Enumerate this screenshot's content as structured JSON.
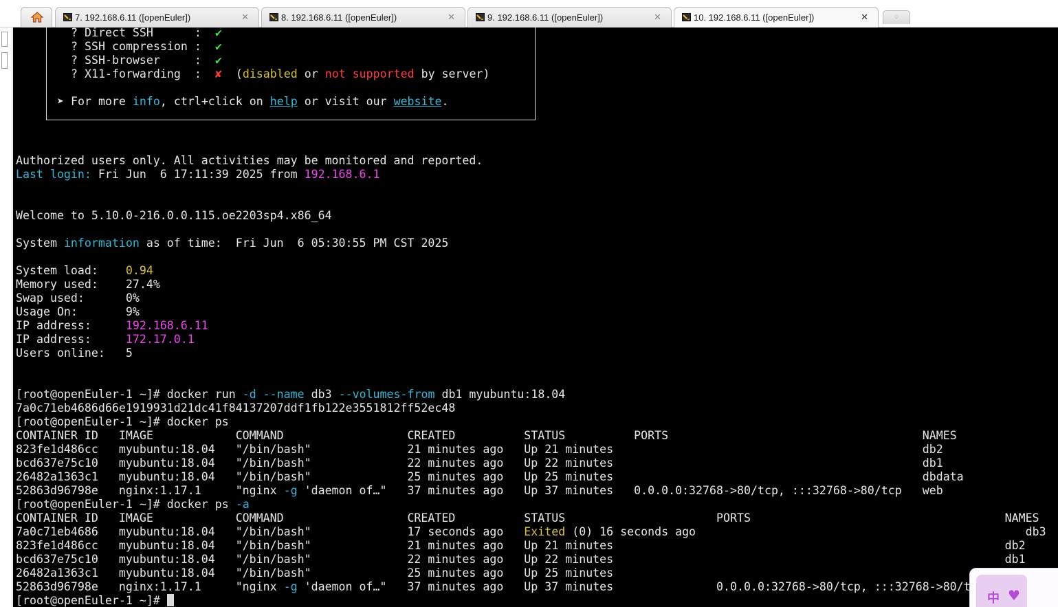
{
  "tabs": {
    "home_icon": "home-icon",
    "session_icon": "terminal-session-icon",
    "close_glyph": "✕",
    "new_tab_glyph": "◌",
    "items": [
      {
        "label": "7. 192.168.6.11 ([openEuler])"
      },
      {
        "label": "8. 192.168.6.11 ([openEuler])"
      },
      {
        "label": "9. 192.168.6.11 ([openEuler])"
      },
      {
        "label": "10. 192.168.6.11 ([openEuler])"
      }
    ],
    "active_index": 3
  },
  "colors": {
    "terminal_bg": "#000000",
    "terminal_fg": "#e6e6e6",
    "ok_green": "#3fe03f",
    "error_red": "#ff3b3b",
    "warn_yellow": "#d6c23a",
    "ip_magenta": "#f046f0",
    "info_cyan": "#36b7d8"
  },
  "banner": {
    "features": [
      {
        "bullet": "?",
        "name": "Direct SSH      ",
        "sep": ":",
        "mark": "✔"
      },
      {
        "bullet": "?",
        "name": "SSH compression ",
        "sep": ":",
        "mark": "✔"
      },
      {
        "bullet": "?",
        "name": "SSH-browser     ",
        "sep": ":",
        "mark": "✔"
      },
      {
        "bullet": "?",
        "name": "X11-forwarding  ",
        "sep": ":",
        "mark": "✘"
      }
    ],
    "x11_note": {
      "open": "(",
      "disabled": "disabled",
      "or": " or ",
      "not_supported": "not supported",
      "rest": " by server)"
    },
    "more": {
      "arrow": "➤",
      "prefix": " For more ",
      "info": "info",
      "mid": ", ctrl+click on ",
      "help": "help",
      "mid2": " or visit our ",
      "website": "website",
      "end": "."
    }
  },
  "login": {
    "authorized": "Authorized users only. All activities may be monitored and reported.",
    "last_login_label": "Last login:",
    "last_login_value": " Fri Jun  6 17:11:39 2025 from ",
    "last_login_ip": "192.168.6.1",
    "welcome": "Welcome to 5.10.0-216.0.0.115.oe2203sp4.x86_64",
    "sysinfo_prefix": "System ",
    "sysinfo_word": "information",
    "sysinfo_rest": " as of time:  Fri Jun  6 05:30:55 PM CST 2025"
  },
  "stats": [
    {
      "label": "System load:    ",
      "value": "0.94",
      "color": "yellow"
    },
    {
      "label": "Memory used:    ",
      "value": "27.4%",
      "color": "plain"
    },
    {
      "label": "Swap used:      ",
      "value": "0%",
      "color": "plain"
    },
    {
      "label": "Usage On:       ",
      "value": "9%",
      "color": "plain"
    },
    {
      "label": "IP address:     ",
      "value": "192.168.6.11",
      "color": "magenta"
    },
    {
      "label": "IP address:     ",
      "value": "172.17.0.1",
      "color": "magenta"
    },
    {
      "label": "Users online:   ",
      "value": "5",
      "color": "plain"
    }
  ],
  "commands": {
    "prompt": "[root@openEuler-1 ~]# ",
    "run": {
      "cmd": "docker run ",
      "f1": "-d",
      "sp1": " ",
      "f2": "--name",
      "arg1": " db3 ",
      "f3": "--volumes-from",
      "arg2": " db1 myubuntu:18.04"
    },
    "run_output": "7a0c71eb4686d66e1919931d21dc41f84137207ddf1fb122e3551812ff52ec48",
    "ps": "docker ps",
    "ps_a_cmd": "docker ps ",
    "ps_a_flag": "-a"
  },
  "ps_table": {
    "header": "CONTAINER ID   IMAGE            COMMAND                  CREATED          STATUS          PORTS                                     NAMES",
    "rows": [
      {
        "pre": "823fe1d486cc   myubuntu:18.04   \"/bin/bash\"              21 minutes ago   Up 21 minutes                                             db2"
      },
      {
        "pre": "bcd637e75c10   myubuntu:18.04   \"/bin/bash\"              22 minutes ago   Up 22 minutes                                             db1"
      },
      {
        "pre": "26482a1363c1   myubuntu:18.04   \"/bin/bash\"              25 minutes ago   Up 25 minutes                                             dbdata"
      }
    ],
    "nginx": {
      "a": "52863d96798e   nginx:1.17.1     \"nginx ",
      "flag": "-g",
      "b": " 'daemon of…\"   37 minutes ago   Up 37 minutes   0.0.0.0:32768->80/tcp, :::32768->80/tcp   web"
    }
  },
  "ps_a_table": {
    "header": "CONTAINER ID   IMAGE            COMMAND                  CREATED          STATUS                      PORTS                                     NAMES",
    "exited_row": {
      "a": "7a0c71eb4686   myubuntu:18.04   \"/bin/bash\"              17 seconds ago   ",
      "exited": "Exited",
      "b": " (0) 16 seconds ago                                                db3"
    },
    "rows": [
      {
        "pre": "823fe1d486cc   myubuntu:18.04   \"/bin/bash\"              21 minutes ago   Up 21 minutes                                                         db2"
      },
      {
        "pre": "bcd637e75c10   myubuntu:18.04   \"/bin/bash\"              22 minutes ago   Up 22 minutes                                                         db1"
      },
      {
        "pre": "26482a1363c1   myubuntu:18.04   \"/bin/bash\"              25 minutes ago   Up 25 minutes"
      }
    ],
    "nginx": {
      "a": "52863d96798e   nginx:1.17.1     \"nginx ",
      "flag": "-g",
      "b": " 'daemon of…\"   37 minutes ago   Up 37 minutes               0.0.0.0:32768->80/tcp, :::32768->80/t"
    }
  },
  "widget": {
    "char": "中",
    "heart": "♥"
  }
}
